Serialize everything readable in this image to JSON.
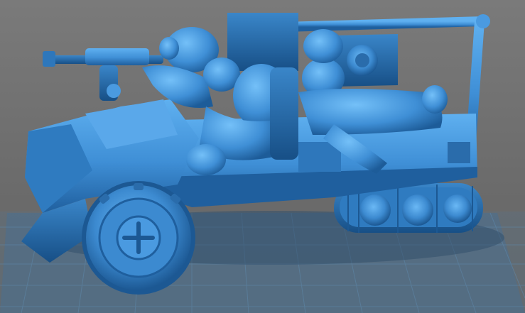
{
  "scene": {
    "subject": "3d-printed-model-preview",
    "colors": {
      "background": "#6e6e6e",
      "model_base": "#3f8fd6",
      "model_light": "#5fb0f0",
      "model_dark": "#1f5f9e",
      "model_shadow": "#164a7c",
      "build_plate": "#4a6f8f",
      "build_grid": "#5d86a8"
    }
  }
}
